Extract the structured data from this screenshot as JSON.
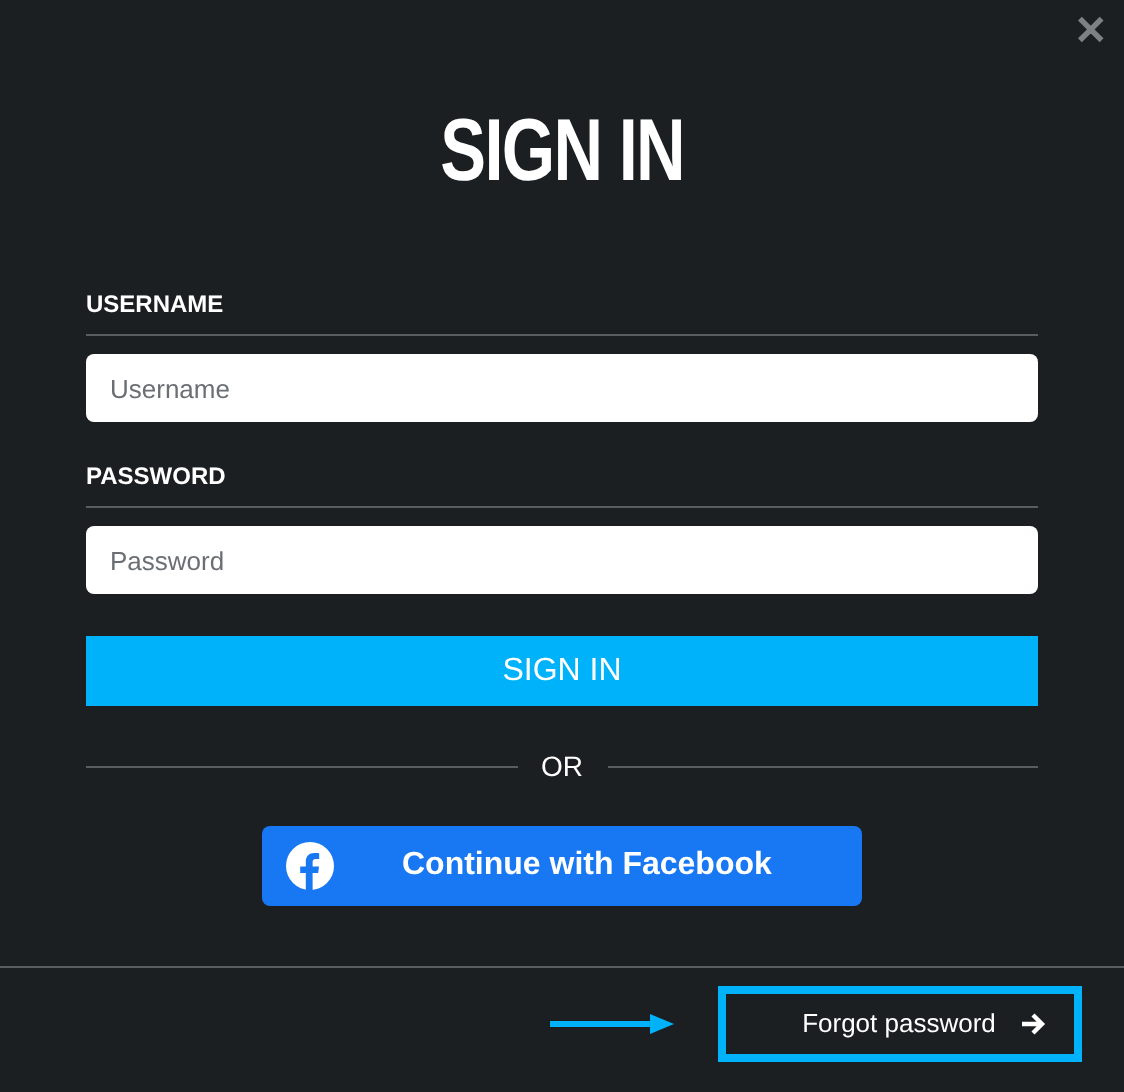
{
  "close_button": {
    "label": "✕"
  },
  "title": "SIGN IN",
  "fields": [
    {
      "label": "USERNAME",
      "placeholder": "Username"
    },
    {
      "label": "PASSWORD",
      "placeholder": "Password"
    }
  ],
  "submit_button": "SIGN IN",
  "separator": "OR",
  "facebook_button": "Continue with Facebook",
  "forgot_link": {
    "label": "Forgot password",
    "highlighted": true
  }
}
